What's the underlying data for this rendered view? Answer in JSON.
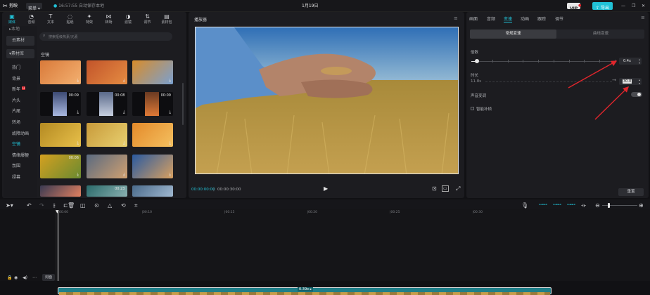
{
  "titlebar": {
    "app_name": "剪映",
    "menu_label": "菜单",
    "autosave": "16:57:55 自动保存本地",
    "project_title": "1月19日",
    "vip_badge": "VIP",
    "export_label": "导出"
  },
  "toolbar": {
    "tabs": [
      {
        "label": "媒体",
        "icon": "media-icon",
        "glyph": "▣"
      },
      {
        "label": "音频",
        "icon": "audio-icon",
        "glyph": "◔"
      },
      {
        "label": "文本",
        "icon": "text-icon",
        "glyph": "T"
      },
      {
        "label": "贴纸",
        "icon": "sticker-icon",
        "glyph": "◌"
      },
      {
        "label": "特效",
        "icon": "effects-icon",
        "glyph": "✦"
      },
      {
        "label": "转场",
        "icon": "transition-icon",
        "glyph": "⋈"
      },
      {
        "label": "滤镜",
        "icon": "filter-icon",
        "glyph": "◑"
      },
      {
        "label": "调节",
        "icon": "adjust-icon",
        "glyph": "⇅"
      },
      {
        "label": "素材包",
        "icon": "package-icon",
        "glyph": "▤"
      }
    ]
  },
  "sidebar": {
    "partial_top": "▸本地",
    "cloud": "云素材",
    "library": "▾素材库",
    "items": [
      "热门",
      "背景",
      "新年",
      "片头",
      "片尾",
      "转场",
      "故障动画",
      "空镜",
      "情绪爆梗",
      "氛围",
      "绿幕"
    ],
    "new_badge": "H"
  },
  "media": {
    "search_placeholder": "搜索抠级热素/元素",
    "section_title": "空镜",
    "durations": [
      "00:09",
      "00:08",
      "00:09",
      "00:06",
      "00:23"
    ]
  },
  "player": {
    "title": "播放器",
    "current_time": "00:00:00:00",
    "total_time": "00:00:30:00"
  },
  "properties": {
    "tabs": [
      "画面",
      "音频",
      "变速",
      "动画",
      "跟踪",
      "调节"
    ],
    "active_tab": "变速",
    "subtabs": [
      "常规变速",
      "曲线变速"
    ],
    "multiplier_label": "倍数",
    "multiplier_value": "0.4x",
    "multiplier_level": 0.04,
    "duration_label": "时长",
    "duration_original": "11.8s",
    "duration_value": "30.0",
    "pitch_label": "声音变调",
    "smooth_label": "智能补帧",
    "reset_label": "重置"
  },
  "timeline": {
    "ticks": [
      "00:00",
      "|00:10",
      "|00:15",
      "|00:20",
      "|00:25",
      "|00:30"
    ],
    "clip_speed": "0.39x ▸",
    "track_label": "封面"
  },
  "colors": {
    "accent": "#21c1d6",
    "annotation_arrow": "#e0262c"
  }
}
